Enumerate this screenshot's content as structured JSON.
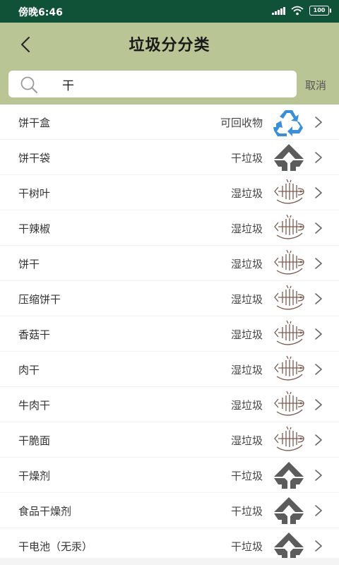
{
  "status_bar": {
    "time": "傍晚6:46",
    "battery": "100"
  },
  "header": {
    "title": "垃圾分分类"
  },
  "search": {
    "value": "干",
    "cancel_label": "取消"
  },
  "results": [
    {
      "name": "饼干盒",
      "category": "可回收物",
      "icon": "recycle-icon"
    },
    {
      "name": "饼干袋",
      "category": "干垃圾",
      "icon": "dry-waste-icon"
    },
    {
      "name": "干树叶",
      "category": "湿垃圾",
      "icon": "wet-waste-icon"
    },
    {
      "name": "干辣椒",
      "category": "湿垃圾",
      "icon": "wet-waste-icon"
    },
    {
      "name": "饼干",
      "category": "湿垃圾",
      "icon": "wet-waste-icon"
    },
    {
      "name": "压缩饼干",
      "category": "湿垃圾",
      "icon": "wet-waste-icon"
    },
    {
      "name": "香菇干",
      "category": "湿垃圾",
      "icon": "wet-waste-icon"
    },
    {
      "name": "肉干",
      "category": "湿垃圾",
      "icon": "wet-waste-icon"
    },
    {
      "name": "牛肉干",
      "category": "湿垃圾",
      "icon": "wet-waste-icon"
    },
    {
      "name": "干脆面",
      "category": "湿垃圾",
      "icon": "wet-waste-icon"
    },
    {
      "name": "干燥剂",
      "category": "干垃圾",
      "icon": "dry-waste-icon"
    },
    {
      "name": "食品干燥剂",
      "category": "干垃圾",
      "icon": "dry-waste-icon"
    },
    {
      "name": "干电池（无汞）",
      "category": "干垃圾",
      "icon": "dry-waste-icon"
    }
  ],
  "colors": {
    "status_bar": "#0f5238",
    "header": "#b9c594",
    "recycle_blue": "#3b8ed8",
    "dry_gray": "#5c5c5c",
    "wet_brown": "#7a5a4e"
  }
}
